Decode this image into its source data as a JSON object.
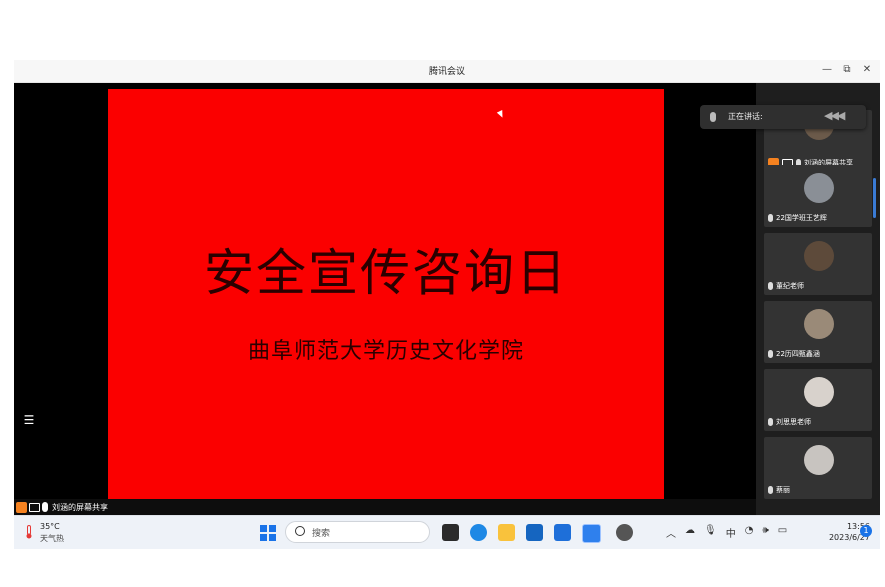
{
  "window": {
    "title": "腾讯会议",
    "minimize_label": "—",
    "restore_label": "⧉",
    "close_label": "✕"
  },
  "slide": {
    "title": "安全宣传咨询日",
    "subtitle": "曲阜师范大学历史文化学院"
  },
  "share_bar": {
    "label": "刘涵的屏幕共享",
    "list_icon_glyph": "☰"
  },
  "speaking": {
    "label": "正在讲话:",
    "wave_glyph": "◀◀◀"
  },
  "participants": [
    {
      "name": "刘涵的屏幕共享",
      "avatar_color": "#6b5a4a"
    },
    {
      "name": "22国学班王艺辉",
      "avatar_color": "#8a8f96"
    },
    {
      "name": "董纪老师",
      "avatar_color": "#5d4a3a"
    },
    {
      "name": "22历四甄鑫涵",
      "avatar_color": "#9a8a78"
    },
    {
      "name": "刘思思老师",
      "avatar_color": "#d8d2cc"
    },
    {
      "name": "蔡丽",
      "avatar_color": "#c8c4c0"
    }
  ],
  "taskbar": {
    "weather_temp": "35°C",
    "weather_desc": "天气热",
    "search_placeholder": "搜索",
    "tray_chevron": "︿",
    "tray_input_lang": "中",
    "tray_volume_glyph": "🕪",
    "clock_time": "13:56",
    "clock_date": "2023/6/27",
    "notification_count": "1"
  },
  "colors": {
    "slide_bg": "#fb0000",
    "accent_blue": "#1a73e8",
    "share_orange": "#f58220"
  }
}
